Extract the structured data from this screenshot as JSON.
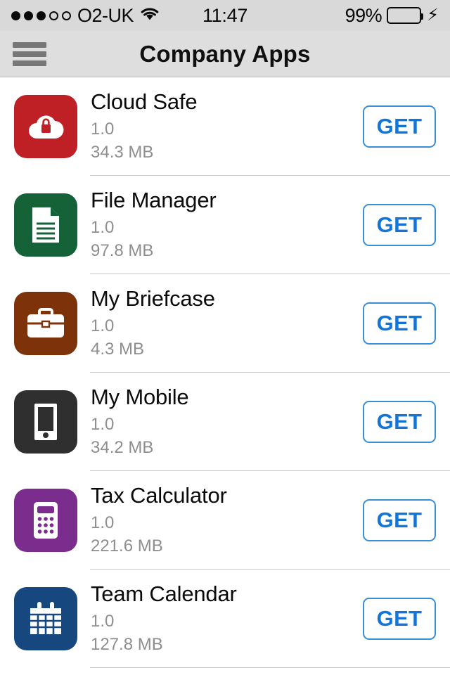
{
  "status_bar": {
    "carrier": "O2-UK",
    "signal_dots_filled": 3,
    "signal_dots_total": 5,
    "wifi_icon": "wifi-icon",
    "time": "11:47",
    "battery_percent": "99%",
    "battery_level": 99,
    "charging": true,
    "battery_color": "#4cd964",
    "bolt_icon": "lightning-bolt-icon",
    "background": "#d9d9d9"
  },
  "nav_bar": {
    "menu_icon": "hamburger-menu-icon",
    "title": "Company Apps",
    "background": "#dedede"
  },
  "apps": [
    {
      "name": "Cloud Safe",
      "version": "1.0",
      "size": "34.3 MB",
      "action_label": "GET",
      "icon": "cloud-lock-icon",
      "icon_color": "#bf2026"
    },
    {
      "name": "File Manager",
      "version": "1.0",
      "size": "97.8 MB",
      "action_label": "GET",
      "icon": "document-icon",
      "icon_color": "#156138"
    },
    {
      "name": "My Briefcase",
      "version": "1.0",
      "size": "4.3 MB",
      "action_label": "GET",
      "icon": "briefcase-icon",
      "icon_color": "#7d3209"
    },
    {
      "name": "My Mobile",
      "version": "1.0",
      "size": "34.2 MB",
      "action_label": "GET",
      "icon": "smartphone-icon",
      "icon_color": "#2f2f2f"
    },
    {
      "name": "Tax Calculator",
      "version": "1.0",
      "size": "221.6 MB",
      "action_label": "GET",
      "icon": "calculator-icon",
      "icon_color": "#7b2d8e"
    },
    {
      "name": "Team Calendar",
      "version": "1.0",
      "size": "127.8 MB",
      "action_label": "GET",
      "icon": "calendar-icon",
      "icon_color": "#16477f"
    }
  ],
  "theme": {
    "accent": "#1275d8",
    "button_border": "#3b8fd4",
    "separator": "#c8c8c8",
    "secondary_text": "#8e8e8e"
  }
}
